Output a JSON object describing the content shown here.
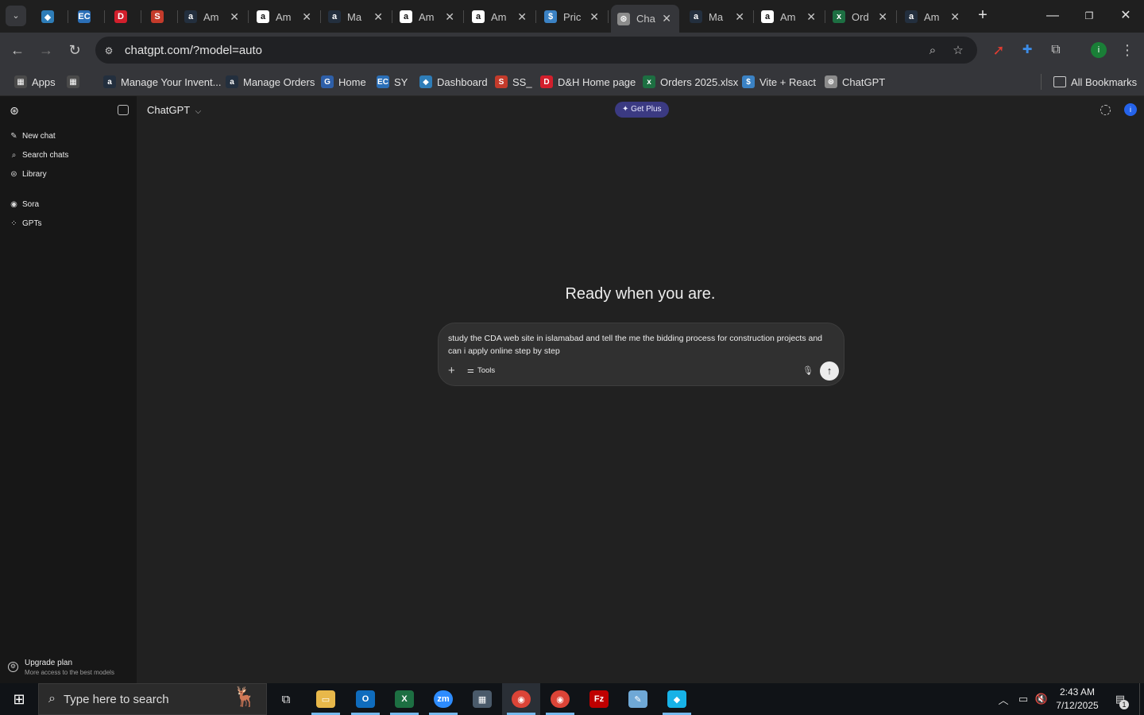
{
  "browser": {
    "tabs": [
      {
        "name": "tab-1",
        "label": "",
        "icon": "kodi-icon",
        "color": "#2e7db8",
        "glyph": "◆"
      },
      {
        "name": "tab-2",
        "label": "",
        "icon": "ec-icon",
        "color": "#2b6fb7",
        "glyph": "EC"
      },
      {
        "name": "tab-3",
        "label": "",
        "icon": "dh-icon",
        "color": "#d21f2c",
        "glyph": "D"
      },
      {
        "name": "tab-4",
        "label": "",
        "icon": "ss-icon",
        "color": "#c43b2b",
        "glyph": "S"
      },
      {
        "name": "tab-5",
        "label": "Am",
        "icon": "amazon-icon",
        "color": "#232f3e",
        "glyph": "a"
      },
      {
        "name": "tab-6",
        "label": "Am",
        "icon": "amazon-icon",
        "color": "#ffffff",
        "glyph": "a"
      },
      {
        "name": "tab-7",
        "label": "Ma",
        "icon": "amazon-icon",
        "color": "#232f3e",
        "glyph": "a"
      },
      {
        "name": "tab-8",
        "label": "Am",
        "icon": "amazon-icon",
        "color": "#ffffff",
        "glyph": "a"
      },
      {
        "name": "tab-9",
        "label": "Am",
        "icon": "amazon-icon",
        "color": "#ffffff",
        "glyph": "a"
      },
      {
        "name": "tab-10",
        "label": "Pric",
        "icon": "dollar-icon",
        "color": "#3b82c4",
        "glyph": "$"
      },
      {
        "name": "tab-11",
        "label": "Cha",
        "icon": "chatgpt-icon",
        "color": "#8c8c8c",
        "glyph": "⊛"
      },
      {
        "name": "tab-12",
        "label": "Ma",
        "icon": "amazon-icon",
        "color": "#232f3e",
        "glyph": "a"
      },
      {
        "name": "tab-13",
        "label": "Am",
        "icon": "amazon-icon",
        "color": "#ffffff",
        "glyph": "a"
      },
      {
        "name": "tab-14",
        "label": "Ord",
        "icon": "excel-icon",
        "color": "#1d6f42",
        "glyph": "x"
      },
      {
        "name": "tab-15",
        "label": "Am",
        "icon": "amazon-icon",
        "color": "#232f3e",
        "glyph": "a"
      }
    ],
    "url": "chatgpt.com/?model=auto",
    "bookmarks": [
      {
        "label": "Apps",
        "icon": "apps-grid-icon",
        "color": "#4a4a4a"
      },
      {
        "label": "",
        "icon": "tab-groups-icon",
        "color": "#4a4a4a"
      },
      {
        "label": "Manage Your Invent...",
        "icon": "amazon-icon",
        "color": "#232f3e"
      },
      {
        "label": "Manage Orders",
        "icon": "amazon-icon",
        "color": "#232f3e"
      },
      {
        "label": "Home",
        "icon": "home-icon",
        "color": "#2e5fa8"
      },
      {
        "label": "SY",
        "icon": "ec-icon",
        "color": "#2b6fb7"
      },
      {
        "label": "Dashboard",
        "icon": "kodi-icon",
        "color": "#2e7db8"
      },
      {
        "label": "SS_",
        "icon": "ss-icon",
        "color": "#c43b2b"
      },
      {
        "label": "D&H Home page",
        "icon": "dh-icon",
        "color": "#d21f2c"
      },
      {
        "label": "Orders 2025.xlsx",
        "icon": "excel-icon",
        "color": "#1d6f42"
      },
      {
        "label": "Vite + React",
        "icon": "dollar-icon",
        "color": "#3b82c4"
      },
      {
        "label": "ChatGPT",
        "icon": "chatgpt-icon",
        "color": "#8c8c8c"
      }
    ],
    "all_bookmarks": "All Bookmarks"
  },
  "sidebar": {
    "items": [
      {
        "label": "New chat",
        "icon": "new-chat-icon"
      },
      {
        "label": "Search chats",
        "icon": "search-icon"
      },
      {
        "label": "Library",
        "icon": "library-icon"
      },
      {
        "label": "Sora",
        "icon": "sora-icon"
      },
      {
        "label": "GPTs",
        "icon": "gpts-icon"
      }
    ],
    "upgrade": {
      "title": "Upgrade plan",
      "subtitle": "More access to the best models"
    }
  },
  "main": {
    "model": "ChatGPT",
    "get_plus": "Get Plus",
    "heading": "Ready when you are.",
    "composer": {
      "text": "study the CDA web site in islamabad  and tell the me the bidding process for construction projects and can i apply online  step by step",
      "tools": "Tools"
    }
  },
  "taskbar": {
    "search_placeholder": "Type here to search",
    "time": "2:43 AM",
    "date": "7/12/2025",
    "notifications": "1"
  },
  "colors": {
    "accent": "#3b3a82",
    "sidebar": "#171717",
    "main": "#212121",
    "composer": "#303030"
  }
}
